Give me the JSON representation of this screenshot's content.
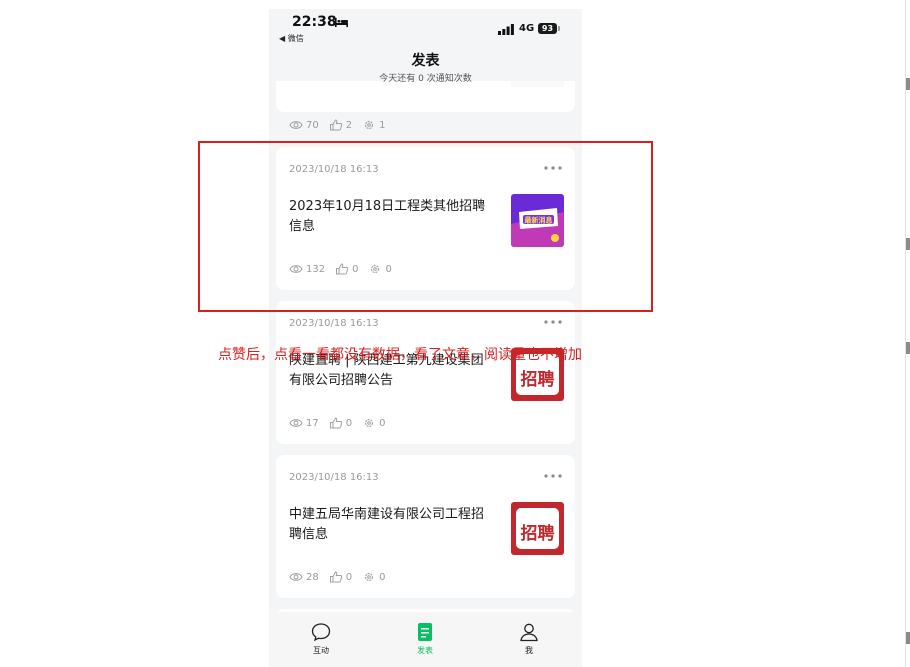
{
  "status_bar": {
    "time": "22:38",
    "back_app": "◀ 微信",
    "network": "4G",
    "battery": "93"
  },
  "nav": {
    "title": "发表",
    "subtitle": "今天还有 0 次通知次数"
  },
  "cards": [
    {
      "date": "",
      "title": "",
      "views": "70",
      "likes": "2",
      "shares": "1",
      "thumb": "green-badge"
    },
    {
      "date": "2023/10/18 16:13",
      "title": "2023年10月18日工程类其他招聘信息",
      "views": "132",
      "likes": "0",
      "shares": "0",
      "thumb": "最新消息"
    },
    {
      "date": "2023/10/18 16:13",
      "title": "陕建直聘 | 陕西建工第九建设集团有限公司招聘公告",
      "views": "17",
      "likes": "0",
      "shares": "0",
      "thumb": "招聘"
    },
    {
      "date": "2023/10/18 16:13",
      "title": "中建五局华南建设有限公司工程招聘信息",
      "views": "28",
      "likes": "0",
      "shares": "0",
      "thumb": "招聘"
    }
  ],
  "tabs": [
    {
      "label": "互动",
      "icon": "chat-bubble-icon"
    },
    {
      "label": "发表",
      "icon": "document-icon"
    },
    {
      "label": "我",
      "icon": "person-icon"
    }
  ],
  "annotation": {
    "text": "点赞后，点看一看都没有数据，看了文章，阅读量也不增加",
    "color": "#d92020"
  },
  "colors": {
    "accent": "#07c160",
    "background": "#f4f5f7",
    "meta_text": "#9a9a9a"
  }
}
